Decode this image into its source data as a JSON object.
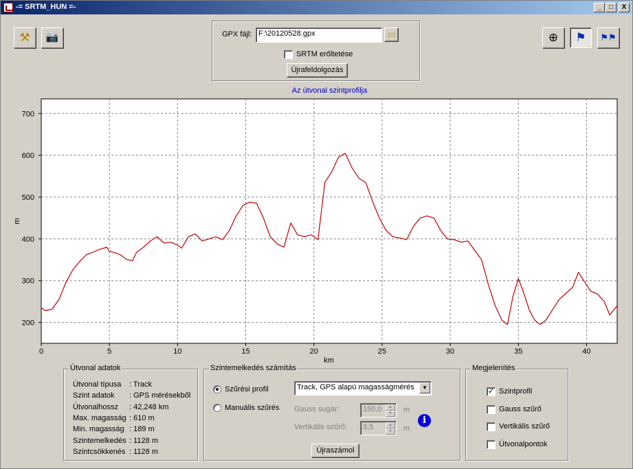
{
  "window": {
    "title": "-= SRTM_HUN =-",
    "min_glyph": "_",
    "max_glyph": "□",
    "close_glyph": "X"
  },
  "toolbar_left": [
    {
      "name": "settings-tools",
      "icon": "tools-icon",
      "glyph": "⚒"
    },
    {
      "name": "camera",
      "icon": "camera-icon",
      "glyph": "📷"
    }
  ],
  "toolbar_right": [
    {
      "name": "zoom",
      "icon": "zoom-in-icon",
      "glyph": "⊕"
    },
    {
      "name": "flag-single",
      "icon": "flag-icon",
      "glyph": "⚑"
    },
    {
      "name": "flag-multi",
      "icon": "flags-icon",
      "glyph": "⚑⚑"
    }
  ],
  "gpx": {
    "label": "GPX fájl:",
    "value": "F:\\20120528.gpx",
    "force_srtm_label": "SRTM erőltetése",
    "force_srtm_checked": false,
    "reprocess_label": "Újrafeldolgozás"
  },
  "chart_data": {
    "type": "line",
    "title": "Az útvonal szintprofilja",
    "xlabel": "km",
    "ylabel": "m",
    "xlim": [
      0,
      42.248
    ],
    "ylim": [
      150,
      735
    ],
    "x_ticks": [
      0,
      5,
      10,
      15,
      20,
      25,
      30,
      35,
      40
    ],
    "y_ticks": [
      200,
      300,
      400,
      500,
      600,
      700
    ],
    "grid": true,
    "line_color": "#c00000",
    "series": [
      {
        "x": [
          0,
          0.3,
          0.8,
          1.3,
          1.8,
          2.3,
          2.8,
          3.3,
          3.8,
          4.3,
          4.8,
          5.0,
          5.3,
          5.8,
          6.3,
          6.7,
          7.0,
          7.5,
          8.0,
          8.5,
          9.0,
          9.5,
          10.0,
          10.3,
          10.8,
          11.3,
          11.8,
          12.3,
          12.8,
          13.3,
          13.8,
          14.3,
          14.8,
          15.3,
          15.8,
          16.3,
          16.8,
          17.3,
          17.8,
          18.3,
          18.8,
          19.3,
          19.8,
          20.3,
          20.8,
          21.3,
          21.8,
          22.3,
          22.8,
          23.3,
          23.8,
          24.3,
          24.8,
          25.3,
          25.8,
          26.3,
          26.8,
          27.3,
          27.8,
          28.3,
          28.8,
          29.3,
          29.8,
          30.3,
          30.8,
          31.3,
          31.8,
          32.3,
          32.8,
          33.3,
          33.8,
          34.2,
          34.6,
          35.0,
          35.4,
          35.8,
          36.2,
          36.6,
          37.0,
          37.5,
          38.0,
          38.5,
          39.0,
          39.4,
          39.8,
          40.3,
          40.8,
          41.3,
          41.7,
          42.248
        ],
        "y": [
          235,
          228,
          232,
          255,
          295,
          325,
          345,
          362,
          368,
          375,
          380,
          370,
          368,
          362,
          350,
          348,
          368,
          380,
          395,
          405,
          390,
          392,
          385,
          378,
          405,
          412,
          395,
          400,
          405,
          398,
          420,
          455,
          480,
          488,
          485,
          450,
          405,
          388,
          380,
          438,
          410,
          405,
          410,
          398,
          535,
          560,
          595,
          605,
          570,
          545,
          535,
          490,
          450,
          420,
          405,
          402,
          398,
          430,
          450,
          455,
          450,
          420,
          400,
          398,
          392,
          395,
          372,
          350,
          290,
          240,
          205,
          195,
          262,
          305,
          270,
          230,
          205,
          195,
          205,
          230,
          255,
          270,
          285,
          320,
          300,
          275,
          268,
          250,
          218,
          240
        ]
      }
    ]
  },
  "route_stats": {
    "group_title": "Útvonal adatok",
    "rows": [
      {
        "label": "Útvonal típusa",
        "value": ": Track"
      },
      {
        "label": "Szint adatok",
        "value": ": GPS mérésekből"
      },
      {
        "label": "Útvonalhossz",
        "value": ": 42,248 km"
      },
      {
        "label": "Max. magasság",
        "value": ": 610 m"
      },
      {
        "label": "Min. magasság",
        "value": ": 189 m"
      },
      {
        "label": "Szintemelkedés",
        "value": ": 1128 m"
      },
      {
        "label": "Szintcsökkenés",
        "value": ": 1128 m"
      }
    ]
  },
  "elevation_calc": {
    "group_title": "Szintemelkedés számítás",
    "filter_profile_label": "Szűrési profil",
    "filter_profile_selected": true,
    "profile_select_value": "Track, GPS alapú magasságmérés",
    "manual_filter_label": "Manuális szűrés",
    "gauss_radius_label": "Gauss sugár:",
    "gauss_radius_value": "150,0",
    "gauss_unit": "m",
    "vertical_filter_label": "Vertikális szűrő:",
    "vertical_filter_value": "3,5",
    "vertical_unit": "m",
    "recalc_label": "Újraszámol",
    "info_glyph": "i"
  },
  "display": {
    "group_title": "Megjelenítés",
    "options": [
      {
        "label": "Szintprofil",
        "checked": true
      },
      {
        "label": "Gauss szűrő",
        "checked": false
      },
      {
        "label": "Vertikális szűrő",
        "checked": false
      },
      {
        "label": "Útvonalpontok",
        "checked": false
      }
    ]
  }
}
